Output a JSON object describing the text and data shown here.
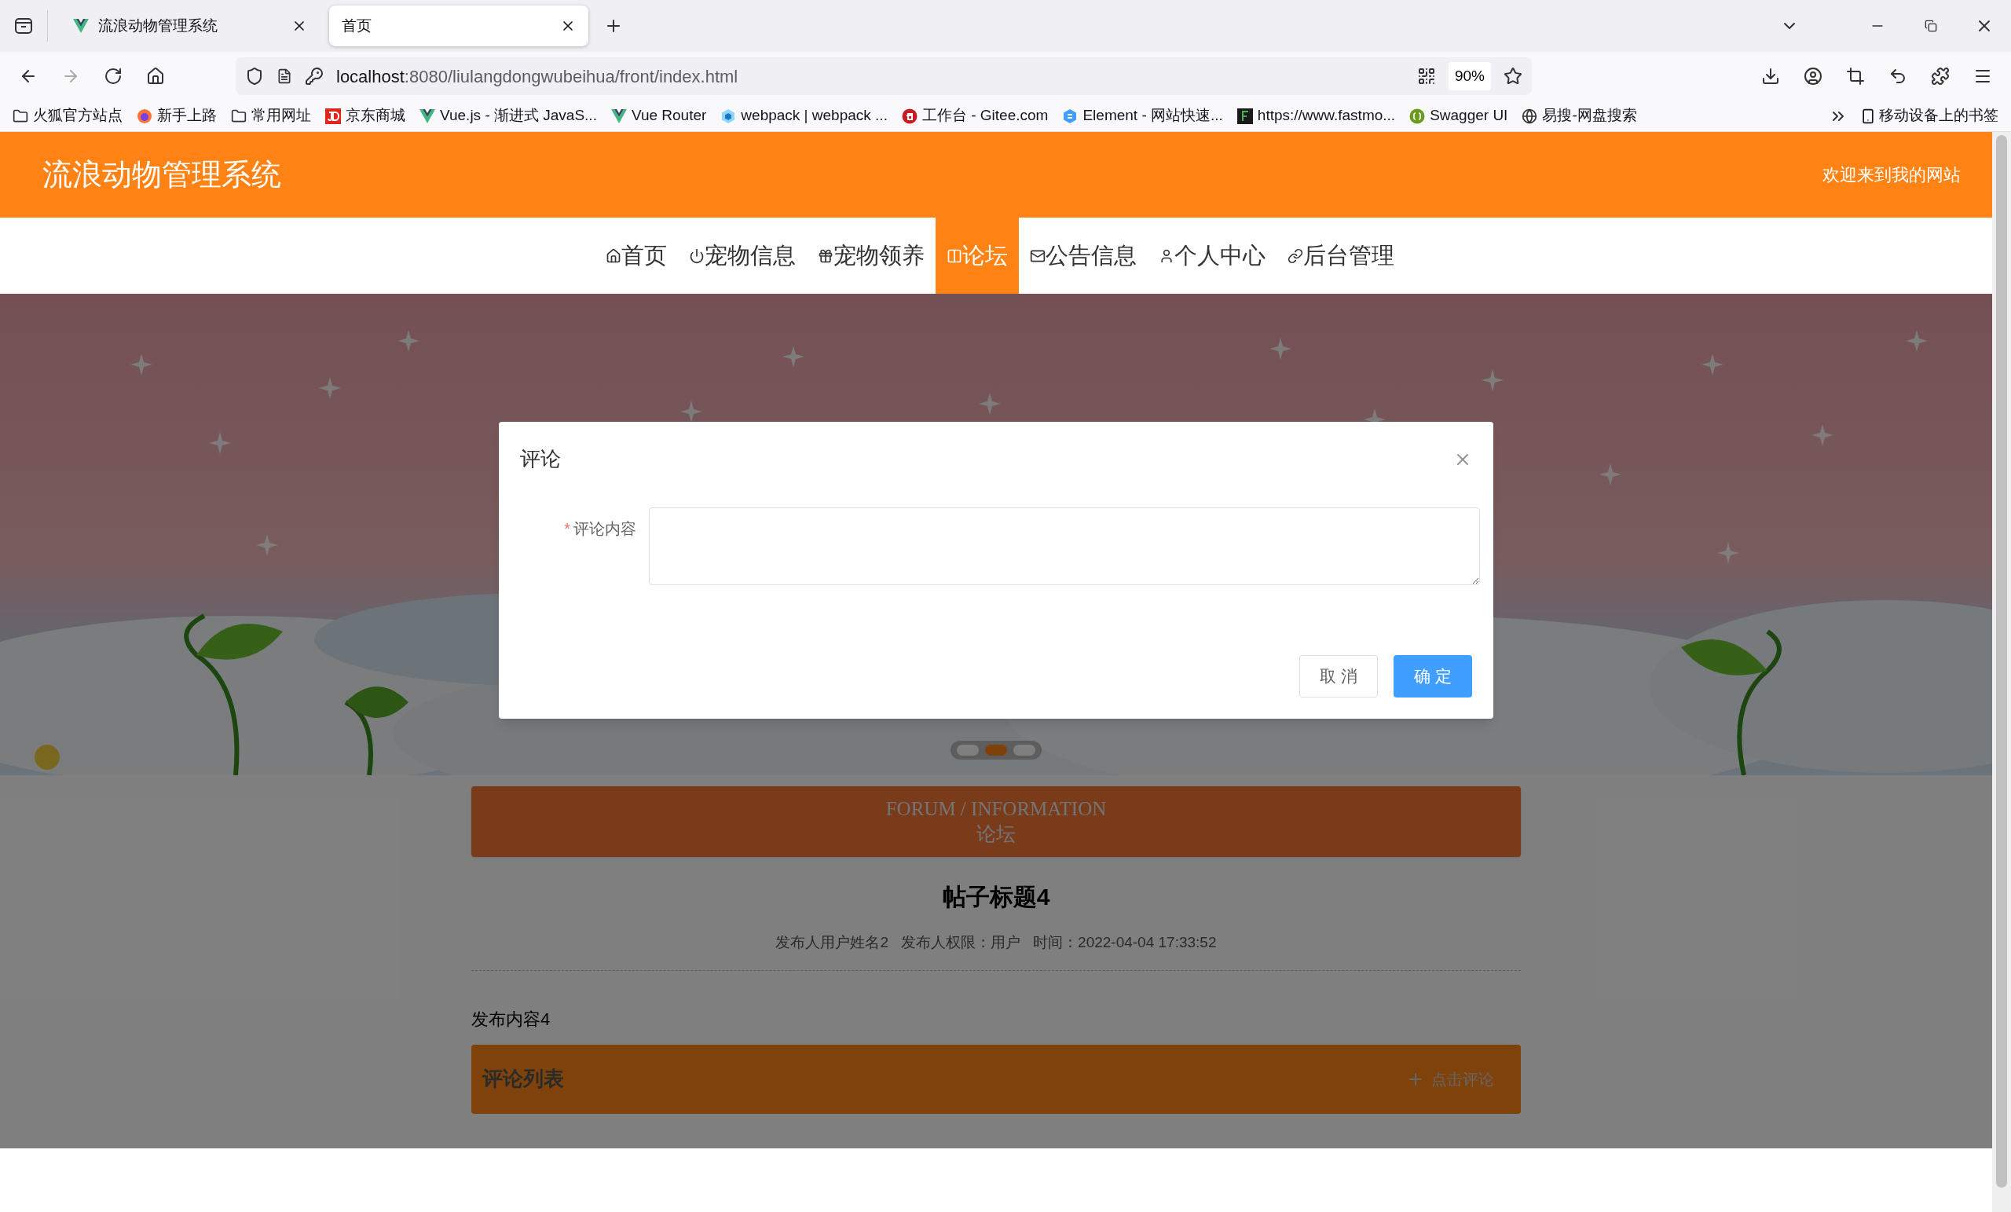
{
  "browser": {
    "tabs": [
      {
        "title": "流浪动物管理系统",
        "selected": false
      },
      {
        "title": "首页",
        "selected": true
      }
    ],
    "url": {
      "host": "localhost",
      "path": ":8080/liulangdongwubeihua/front/index.html"
    },
    "zoom": "90%",
    "bookmarks": [
      {
        "label": "火狐官方站点",
        "kind": "folder"
      },
      {
        "label": "新手上路",
        "kind": "firefox"
      },
      {
        "label": "常用网址",
        "kind": "folder"
      },
      {
        "label": "京东商城",
        "kind": "jd"
      },
      {
        "label": "Vue.js - 渐进式 JavaS...",
        "kind": "vue"
      },
      {
        "label": "Vue Router",
        "kind": "vue"
      },
      {
        "label": "webpack | webpack ...",
        "kind": "webpack"
      },
      {
        "label": "工作台 - Gitee.com",
        "kind": "gitee"
      },
      {
        "label": "Element - 网站快速...",
        "kind": "element"
      },
      {
        "label": "https://www.fastmo...",
        "kind": "fastmock"
      },
      {
        "label": "Swagger UI",
        "kind": "swagger"
      },
      {
        "label": "易搜-网盘搜索",
        "kind": "globe"
      }
    ],
    "mobile_bookmarks": "移动设备上的书签"
  },
  "site": {
    "title": "流浪动物管理系统",
    "welcome": "欢迎来到我的网站",
    "nav": [
      {
        "label": "首页",
        "kind": "home",
        "selected": false
      },
      {
        "label": "宠物信息",
        "kind": "power",
        "selected": false
      },
      {
        "label": "宠物领养",
        "kind": "gift",
        "selected": false
      },
      {
        "label": "论坛",
        "kind": "forum",
        "selected": true
      },
      {
        "label": "公告信息",
        "kind": "mail",
        "selected": false
      },
      {
        "label": "个人中心",
        "kind": "user",
        "selected": false
      },
      {
        "label": "后台管理",
        "kind": "link",
        "selected": false
      }
    ],
    "carousel": [
      {
        "selected": false
      },
      {
        "selected": true
      },
      {
        "selected": false
      }
    ],
    "section": {
      "title_en": "FORUM / INFORMATION",
      "title_zh": "论坛"
    },
    "post": {
      "title": "帖子标题4",
      "meta": [
        "发布人用户姓名2",
        "发布人权限：用户",
        "时间：2022-04-04 17:33:52"
      ],
      "content": "发布内容4"
    },
    "comments": {
      "title": "评论列表",
      "action": "点击评论"
    }
  },
  "dialog": {
    "title": "评论",
    "field": {
      "required_mark": "*",
      "label": "评论内容"
    },
    "buttons": [
      {
        "label": "取 消",
        "kind": "default"
      },
      {
        "label": "确 定",
        "kind": "primary"
      }
    ]
  }
}
